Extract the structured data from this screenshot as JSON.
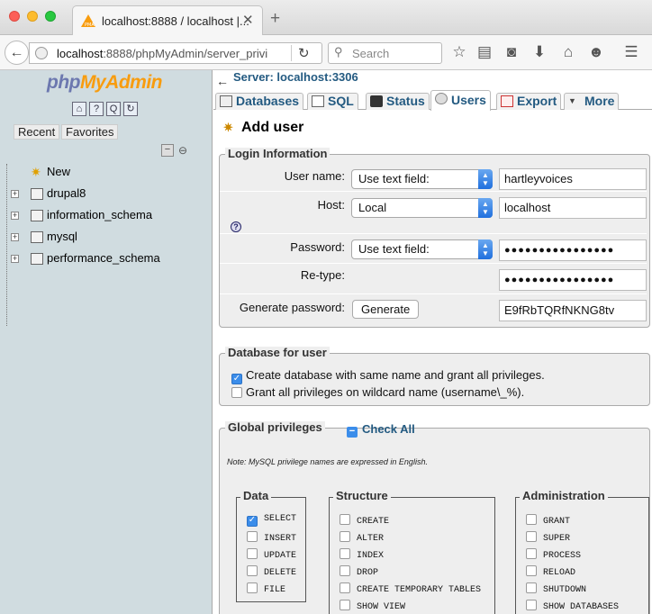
{
  "browser": {
    "tab_title": "localhost:8888 / localhost |...",
    "url_host": "localhost",
    "url_rest": ":8888/phpMyAdmin/server_privi",
    "search_placeholder": "Search"
  },
  "sidebar": {
    "logo_php": "php",
    "logo_myadmin": "MyAdmin",
    "tabs": [
      "Recent",
      "Favorites"
    ],
    "tree": [
      {
        "label": "New"
      },
      {
        "label": "drupal8"
      },
      {
        "label": "information_schema"
      },
      {
        "label": "mysql"
      },
      {
        "label": "performance_schema"
      }
    ]
  },
  "main": {
    "server_label": "Server: localhost:3306",
    "tabs": [
      "Databases",
      "SQL",
      "Status",
      "Users",
      "Export",
      "More"
    ],
    "active_tab": "Users",
    "page_title": "Add user",
    "login": {
      "legend": "Login Information",
      "username_label": "User name:",
      "username_mode": "Use text field:",
      "username_value": "hartleyvoices",
      "host_label": "Host:",
      "host_mode": "Local",
      "host_value": "localhost",
      "password_label": "Password:",
      "password_mode": "Use text field:",
      "password_value": "●●●●●●●●●●●●●●●●",
      "retype_label": "Re-type:",
      "retype_value": "●●●●●●●●●●●●●●●●",
      "generate_label": "Generate password:",
      "generate_button": "Generate",
      "generated_value": "E9fRbTQRfNKNG8tv"
    },
    "dbforuser": {
      "legend": "Database for user",
      "options": [
        {
          "label": "Create database with same name and grant all privileges.",
          "checked": true
        },
        {
          "label": "Grant all privileges on wildcard name (username\\_%).",
          "checked": false
        }
      ]
    },
    "global": {
      "legend": "Global privileges",
      "check_all": "Check All",
      "note": "Note: MySQL privilege names are expressed in English.",
      "groups": [
        {
          "title": "Data",
          "items": [
            {
              "name": "SELECT",
              "checked": true
            },
            {
              "name": "INSERT",
              "checked": false
            },
            {
              "name": "UPDATE",
              "checked": false
            },
            {
              "name": "DELETE",
              "checked": false
            },
            {
              "name": "FILE",
              "checked": false
            }
          ]
        },
        {
          "title": "Structure",
          "items": [
            {
              "name": "CREATE",
              "checked": false
            },
            {
              "name": "ALTER",
              "checked": false
            },
            {
              "name": "INDEX",
              "checked": false
            },
            {
              "name": "DROP",
              "checked": false
            },
            {
              "name": "CREATE TEMPORARY TABLES",
              "checked": false
            },
            {
              "name": "SHOW VIEW",
              "checked": false
            }
          ]
        },
        {
          "title": "Administration",
          "items": [
            {
              "name": "GRANT",
              "checked": false
            },
            {
              "name": "SUPER",
              "checked": false
            },
            {
              "name": "PROCESS",
              "checked": false
            },
            {
              "name": "RELOAD",
              "checked": false
            },
            {
              "name": "SHUTDOWN",
              "checked": false
            },
            {
              "name": "SHOW DATABASES",
              "checked": false
            }
          ]
        }
      ]
    }
  },
  "colors": {
    "link": "#235a81",
    "sidebar_bg": "#d0dce0",
    "checkbox_on": "#3b8dea",
    "logo_php": "#6c78af",
    "logo_myadmin": "#f89c0e"
  },
  "icons": {
    "traffic_lights": [
      "close",
      "minimize",
      "zoom"
    ],
    "navbar": [
      "bookmark-star-icon",
      "reading-list-icon",
      "pocket-icon",
      "download-icon",
      "home-icon",
      "smiley-icon",
      "menu-icon"
    ]
  }
}
